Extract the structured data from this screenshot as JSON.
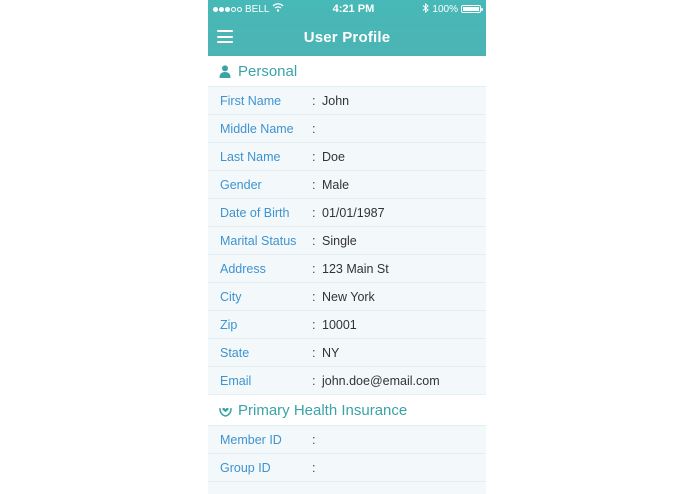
{
  "status_bar": {
    "carrier": "BELL",
    "time": "4:21 PM",
    "battery": "100%",
    "battery_level": 1.0,
    "signal_filled": 3,
    "signal_total": 5
  },
  "nav": {
    "title": "User Profile"
  },
  "colors": {
    "accent": "#4cb4b3",
    "label_blue": "#3f93cf",
    "section_teal": "#3aa3a8"
  },
  "sections": [
    {
      "title": "Personal",
      "icon": "person-icon",
      "separator": ":",
      "fields": [
        {
          "label": "First Name",
          "value": "John"
        },
        {
          "label": "Middle Name",
          "value": ""
        },
        {
          "label": "Last Name",
          "value": "Doe"
        },
        {
          "label": "Gender",
          "value": "Male"
        },
        {
          "label": "Date of Birth",
          "value": "01/01/1987"
        },
        {
          "label": "Marital Status",
          "value": "Single"
        },
        {
          "label": "Address",
          "value": "123 Main St"
        },
        {
          "label": "City",
          "value": "New York"
        },
        {
          "label": "Zip",
          "value": "10001"
        },
        {
          "label": "State",
          "value": "NY"
        },
        {
          "label": "Email",
          "value": "john.doe@email.com"
        }
      ]
    },
    {
      "title": "Primary Health Insurance",
      "icon": "health-hands-icon",
      "separator": ":",
      "fields": [
        {
          "label": "Member ID",
          "value": ""
        },
        {
          "label": "Group ID",
          "value": ""
        }
      ]
    }
  ]
}
